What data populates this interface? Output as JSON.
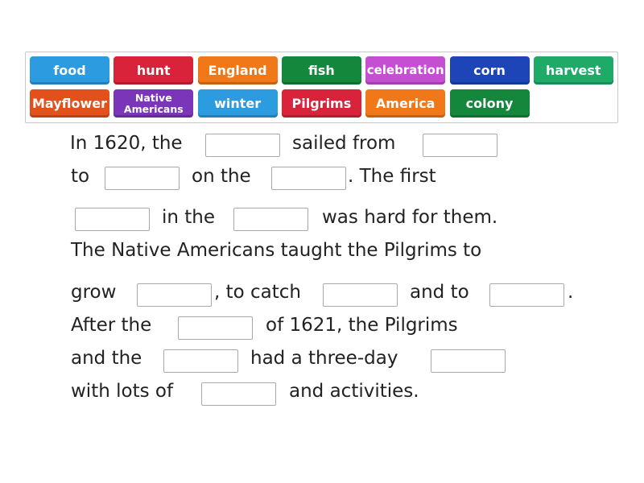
{
  "tiles": [
    {
      "label": "food",
      "color": "#2c9be0"
    },
    {
      "label": "hunt",
      "color": "#d9233a"
    },
    {
      "label": "England",
      "color": "#f07818"
    },
    {
      "label": "fish",
      "color": "#15873c"
    },
    {
      "label": "celebration",
      "color": "#c54fd1"
    },
    {
      "label": "corn",
      "color": "#1d45b8"
    },
    {
      "label": "harvest",
      "color": "#1faa67"
    },
    {
      "label": "Mayflower",
      "color": "#e2511b"
    },
    {
      "label": "Native Americans",
      "color": "#7a35b8"
    },
    {
      "label": "winter",
      "color": "#2c9be0"
    },
    {
      "label": "Pilgrims",
      "color": "#d9233a"
    },
    {
      "label": "America",
      "color": "#f07818"
    },
    {
      "label": "colony",
      "color": "#15873c"
    }
  ],
  "passage": {
    "w1": "In 1620, the",
    "w2": "sailed from",
    "w3": "to",
    "w4": "on the",
    "w5": ". The first",
    "w6": "in the",
    "w7": "was hard for them.",
    "w8": "The Native Americans taught the Pilgrims to",
    "w9": "grow",
    "w10": ", to catch",
    "w11": "and to",
    "w12": ".",
    "w13": "After the",
    "w14": "of 1621, the Pilgrims",
    "w15": "and the",
    "w16": "had a three-day",
    "w17": "with lots of",
    "w18": "and activities."
  }
}
